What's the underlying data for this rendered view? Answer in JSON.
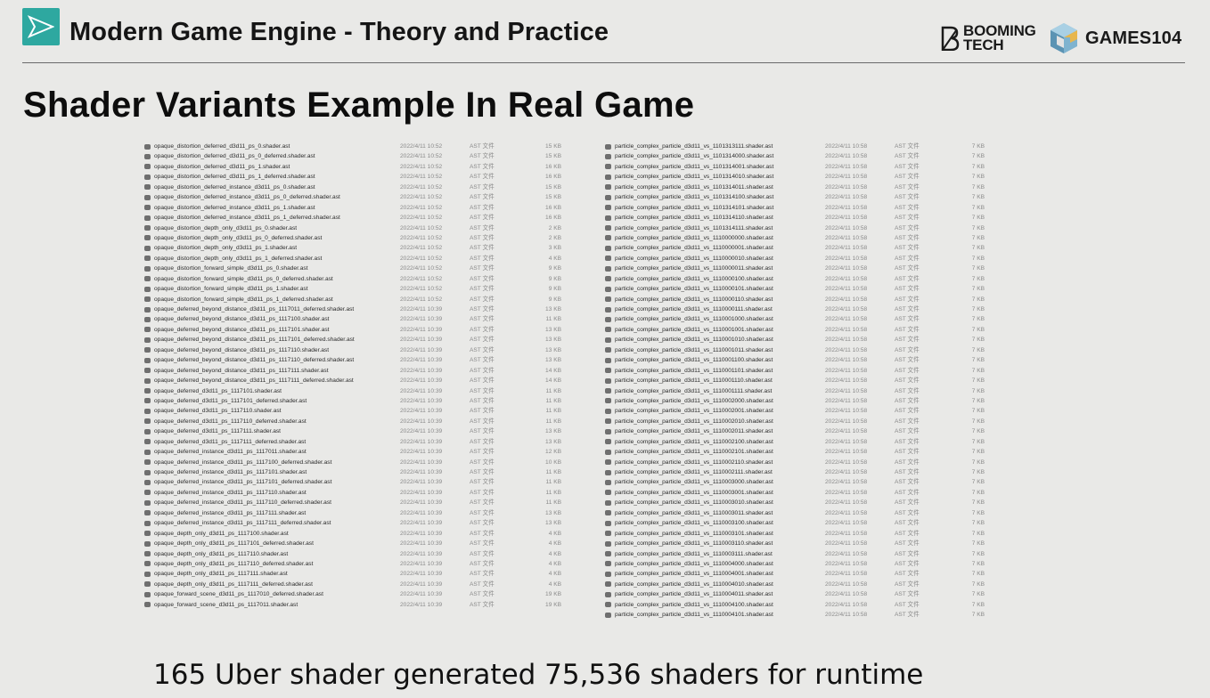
{
  "header": {
    "course_title": "Modern Game Engine - Theory and Practice",
    "booming_line1": "BOOMING",
    "booming_line2": "TECH",
    "games_label": "GAMES104",
    "accent_color": "#2ea8a0"
  },
  "slide": {
    "title": "Shader Variants Example In Real Game",
    "caption": "165 Uber shader generated 75,536 shaders for runtime"
  },
  "file_type_label": "AST 文件",
  "left_files": [
    {
      "name": "opaque_distortion_deferred_d3d11_ps_0.shader.ast",
      "date": "2022/4/11 10:52",
      "size": "15 KB"
    },
    {
      "name": "opaque_distortion_deferred_d3d11_ps_0_deferred.shader.ast",
      "date": "2022/4/11 10:52",
      "size": "15 KB"
    },
    {
      "name": "opaque_distortion_deferred_d3d11_ps_1.shader.ast",
      "date": "2022/4/11 10:52",
      "size": "16 KB"
    },
    {
      "name": "opaque_distortion_deferred_d3d11_ps_1_deferred.shader.ast",
      "date": "2022/4/11 10:52",
      "size": "16 KB"
    },
    {
      "name": "opaque_distortion_deferred_instance_d3d11_ps_0.shader.ast",
      "date": "2022/4/11 10:52",
      "size": "15 KB"
    },
    {
      "name": "opaque_distortion_deferred_instance_d3d11_ps_0_deferred.shader.ast",
      "date": "2022/4/11 10:52",
      "size": "15 KB"
    },
    {
      "name": "opaque_distortion_deferred_instance_d3d11_ps_1.shader.ast",
      "date": "2022/4/11 10:52",
      "size": "16 KB"
    },
    {
      "name": "opaque_distortion_deferred_instance_d3d11_ps_1_deferred.shader.ast",
      "date": "2022/4/11 10:52",
      "size": "16 KB"
    },
    {
      "name": "opaque_distortion_depth_only_d3d11_ps_0.shader.ast",
      "date": "2022/4/11 10:52",
      "size": "2 KB"
    },
    {
      "name": "opaque_distortion_depth_only_d3d11_ps_0_deferred.shader.ast",
      "date": "2022/4/11 10:52",
      "size": "2 KB"
    },
    {
      "name": "opaque_distortion_depth_only_d3d11_ps_1.shader.ast",
      "date": "2022/4/11 10:52",
      "size": "3 KB"
    },
    {
      "name": "opaque_distortion_depth_only_d3d11_ps_1_deferred.shader.ast",
      "date": "2022/4/11 10:52",
      "size": "4 KB"
    },
    {
      "name": "opaque_distortion_forward_simple_d3d11_ps_0.shader.ast",
      "date": "2022/4/11 10:52",
      "size": "9 KB"
    },
    {
      "name": "opaque_distortion_forward_simple_d3d11_ps_0_deferred.shader.ast",
      "date": "2022/4/11 10:52",
      "size": "9 KB"
    },
    {
      "name": "opaque_distortion_forward_simple_d3d11_ps_1.shader.ast",
      "date": "2022/4/11 10:52",
      "size": "9 KB"
    },
    {
      "name": "opaque_distortion_forward_simple_d3d11_ps_1_deferred.shader.ast",
      "date": "2022/4/11 10:52",
      "size": "9 KB"
    },
    {
      "name": "opaque_deferred_beyond_distance_d3d11_ps_1117011_deferred.shader.ast",
      "date": "2022/4/11 10:39",
      "size": "13 KB"
    },
    {
      "name": "opaque_deferred_beyond_distance_d3d11_ps_1117100.shader.ast",
      "date": "2022/4/11 10:39",
      "size": "11 KB"
    },
    {
      "name": "opaque_deferred_beyond_distance_d3d11_ps_1117101.shader.ast",
      "date": "2022/4/11 10:39",
      "size": "13 KB"
    },
    {
      "name": "opaque_deferred_beyond_distance_d3d11_ps_1117101_deferred.shader.ast",
      "date": "2022/4/11 10:39",
      "size": "13 KB"
    },
    {
      "name": "opaque_deferred_beyond_distance_d3d11_ps_1117110.shader.ast",
      "date": "2022/4/11 10:39",
      "size": "13 KB"
    },
    {
      "name": "opaque_deferred_beyond_distance_d3d11_ps_1117110_deferred.shader.ast",
      "date": "2022/4/11 10:39",
      "size": "13 KB"
    },
    {
      "name": "opaque_deferred_beyond_distance_d3d11_ps_1117111.shader.ast",
      "date": "2022/4/11 10:39",
      "size": "14 KB"
    },
    {
      "name": "opaque_deferred_beyond_distance_d3d11_ps_1117111_deferred.shader.ast",
      "date": "2022/4/11 10:39",
      "size": "14 KB"
    },
    {
      "name": "opaque_deferred_d3d11_ps_1117101.shader.ast",
      "date": "2022/4/11 10:39",
      "size": "11 KB"
    },
    {
      "name": "opaque_deferred_d3d11_ps_1117101_deferred.shader.ast",
      "date": "2022/4/11 10:39",
      "size": "11 KB"
    },
    {
      "name": "opaque_deferred_d3d11_ps_1117110.shader.ast",
      "date": "2022/4/11 10:39",
      "size": "11 KB"
    },
    {
      "name": "opaque_deferred_d3d11_ps_1117110_deferred.shader.ast",
      "date": "2022/4/11 10:39",
      "size": "11 KB"
    },
    {
      "name": "opaque_deferred_d3d11_ps_1117111.shader.ast",
      "date": "2022/4/11 10:39",
      "size": "13 KB"
    },
    {
      "name": "opaque_deferred_d3d11_ps_1117111_deferred.shader.ast",
      "date": "2022/4/11 10:39",
      "size": "13 KB"
    },
    {
      "name": "opaque_deferred_instance_d3d11_ps_1117011.shader.ast",
      "date": "2022/4/11 10:39",
      "size": "12 KB"
    },
    {
      "name": "opaque_deferred_instance_d3d11_ps_1117100_deferred.shader.ast",
      "date": "2022/4/11 10:39",
      "size": "10 KB"
    },
    {
      "name": "opaque_deferred_instance_d3d11_ps_1117101.shader.ast",
      "date": "2022/4/11 10:39",
      "size": "11 KB"
    },
    {
      "name": "opaque_deferred_instance_d3d11_ps_1117101_deferred.shader.ast",
      "date": "2022/4/11 10:39",
      "size": "11 KB"
    },
    {
      "name": "opaque_deferred_instance_d3d11_ps_1117110.shader.ast",
      "date": "2022/4/11 10:39",
      "size": "11 KB"
    },
    {
      "name": "opaque_deferred_instance_d3d11_ps_1117110_deferred.shader.ast",
      "date": "2022/4/11 10:39",
      "size": "11 KB"
    },
    {
      "name": "opaque_deferred_instance_d3d11_ps_1117111.shader.ast",
      "date": "2022/4/11 10:39",
      "size": "13 KB"
    },
    {
      "name": "opaque_deferred_instance_d3d11_ps_1117111_deferred.shader.ast",
      "date": "2022/4/11 10:39",
      "size": "13 KB"
    },
    {
      "name": "opaque_depth_only_d3d11_ps_1117100.shader.ast",
      "date": "2022/4/11 10:39",
      "size": "4 KB"
    },
    {
      "name": "opaque_depth_only_d3d11_ps_1117101_deferred.shader.ast",
      "date": "2022/4/11 10:39",
      "size": "4 KB"
    },
    {
      "name": "opaque_depth_only_d3d11_ps_1117110.shader.ast",
      "date": "2022/4/11 10:39",
      "size": "4 KB"
    },
    {
      "name": "opaque_depth_only_d3d11_ps_1117110_deferred.shader.ast",
      "date": "2022/4/11 10:39",
      "size": "4 KB"
    },
    {
      "name": "opaque_depth_only_d3d11_ps_1117111.shader.ast",
      "date": "2022/4/11 10:39",
      "size": "4 KB"
    },
    {
      "name": "opaque_depth_only_d3d11_ps_1117111_deferred.shader.ast",
      "date": "2022/4/11 10:39",
      "size": "4 KB"
    },
    {
      "name": "opaque_forward_scene_d3d11_ps_1117010_deferred.shader.ast",
      "date": "2022/4/11 10:39",
      "size": "19 KB"
    },
    {
      "name": "opaque_forward_scene_d3d11_ps_1117011.shader.ast",
      "date": "2022/4/11 10:39",
      "size": "19 KB"
    }
  ],
  "right_files": [
    {
      "name": "particle_complex_particle_d3d11_vs_1101313111.shader.ast",
      "date": "2022/4/11 10:58",
      "size": "7 KB"
    },
    {
      "name": "particle_complex_particle_d3d11_vs_1101314000.shader.ast",
      "date": "2022/4/11 10:58",
      "size": "7 KB"
    },
    {
      "name": "particle_complex_particle_d3d11_vs_1101314001.shader.ast",
      "date": "2022/4/11 10:58",
      "size": "7 KB"
    },
    {
      "name": "particle_complex_particle_d3d11_vs_1101314010.shader.ast",
      "date": "2022/4/11 10:58",
      "size": "7 KB"
    },
    {
      "name": "particle_complex_particle_d3d11_vs_1101314011.shader.ast",
      "date": "2022/4/11 10:58",
      "size": "7 KB"
    },
    {
      "name": "particle_complex_particle_d3d11_vs_1101314100.shader.ast",
      "date": "2022/4/11 10:58",
      "size": "7 KB"
    },
    {
      "name": "particle_complex_particle_d3d11_vs_1101314101.shader.ast",
      "date": "2022/4/11 10:58",
      "size": "7 KB"
    },
    {
      "name": "particle_complex_particle_d3d11_vs_1101314110.shader.ast",
      "date": "2022/4/11 10:58",
      "size": "7 KB"
    },
    {
      "name": "particle_complex_particle_d3d11_vs_1101314111.shader.ast",
      "date": "2022/4/11 10:58",
      "size": "7 KB"
    },
    {
      "name": "particle_complex_particle_d3d11_vs_1110000000.shader.ast",
      "date": "2022/4/11 10:58",
      "size": "7 KB"
    },
    {
      "name": "particle_complex_particle_d3d11_vs_1110000001.shader.ast",
      "date": "2022/4/11 10:58",
      "size": "7 KB"
    },
    {
      "name": "particle_complex_particle_d3d11_vs_1110000010.shader.ast",
      "date": "2022/4/11 10:58",
      "size": "7 KB"
    },
    {
      "name": "particle_complex_particle_d3d11_vs_1110000011.shader.ast",
      "date": "2022/4/11 10:58",
      "size": "7 KB"
    },
    {
      "name": "particle_complex_particle_d3d11_vs_1110000100.shader.ast",
      "date": "2022/4/11 10:58",
      "size": "7 KB"
    },
    {
      "name": "particle_complex_particle_d3d11_vs_1110000101.shader.ast",
      "date": "2022/4/11 10:58",
      "size": "7 KB"
    },
    {
      "name": "particle_complex_particle_d3d11_vs_1110000110.shader.ast",
      "date": "2022/4/11 10:58",
      "size": "7 KB"
    },
    {
      "name": "particle_complex_particle_d3d11_vs_1110000111.shader.ast",
      "date": "2022/4/11 10:58",
      "size": "7 KB"
    },
    {
      "name": "particle_complex_particle_d3d11_vs_1110001000.shader.ast",
      "date": "2022/4/11 10:58",
      "size": "7 KB"
    },
    {
      "name": "particle_complex_particle_d3d11_vs_1110001001.shader.ast",
      "date": "2022/4/11 10:58",
      "size": "7 KB"
    },
    {
      "name": "particle_complex_particle_d3d11_vs_1110001010.shader.ast",
      "date": "2022/4/11 10:58",
      "size": "7 KB"
    },
    {
      "name": "particle_complex_particle_d3d11_vs_1110001011.shader.ast",
      "date": "2022/4/11 10:58",
      "size": "7 KB"
    },
    {
      "name": "particle_complex_particle_d3d11_vs_1110001100.shader.ast",
      "date": "2022/4/11 10:58",
      "size": "7 KB"
    },
    {
      "name": "particle_complex_particle_d3d11_vs_1110001101.shader.ast",
      "date": "2022/4/11 10:58",
      "size": "7 KB"
    },
    {
      "name": "particle_complex_particle_d3d11_vs_1110001110.shader.ast",
      "date": "2022/4/11 10:58",
      "size": "7 KB"
    },
    {
      "name": "particle_complex_particle_d3d11_vs_1110001111.shader.ast",
      "date": "2022/4/11 10:58",
      "size": "7 KB"
    },
    {
      "name": "particle_complex_particle_d3d11_vs_1110002000.shader.ast",
      "date": "2022/4/11 10:58",
      "size": "7 KB"
    },
    {
      "name": "particle_complex_particle_d3d11_vs_1110002001.shader.ast",
      "date": "2022/4/11 10:58",
      "size": "7 KB"
    },
    {
      "name": "particle_complex_particle_d3d11_vs_1110002010.shader.ast",
      "date": "2022/4/11 10:58",
      "size": "7 KB"
    },
    {
      "name": "particle_complex_particle_d3d11_vs_1110002011.shader.ast",
      "date": "2022/4/11 10:58",
      "size": "7 KB"
    },
    {
      "name": "particle_complex_particle_d3d11_vs_1110002100.shader.ast",
      "date": "2022/4/11 10:58",
      "size": "7 KB"
    },
    {
      "name": "particle_complex_particle_d3d11_vs_1110002101.shader.ast",
      "date": "2022/4/11 10:58",
      "size": "7 KB"
    },
    {
      "name": "particle_complex_particle_d3d11_vs_1110002110.shader.ast",
      "date": "2022/4/11 10:58",
      "size": "7 KB"
    },
    {
      "name": "particle_complex_particle_d3d11_vs_1110002111.shader.ast",
      "date": "2022/4/11 10:58",
      "size": "7 KB"
    },
    {
      "name": "particle_complex_particle_d3d11_vs_1110003000.shader.ast",
      "date": "2022/4/11 10:58",
      "size": "7 KB"
    },
    {
      "name": "particle_complex_particle_d3d11_vs_1110003001.shader.ast",
      "date": "2022/4/11 10:58",
      "size": "7 KB"
    },
    {
      "name": "particle_complex_particle_d3d11_vs_1110003010.shader.ast",
      "date": "2022/4/11 10:58",
      "size": "7 KB"
    },
    {
      "name": "particle_complex_particle_d3d11_vs_1110003011.shader.ast",
      "date": "2022/4/11 10:58",
      "size": "7 KB"
    },
    {
      "name": "particle_complex_particle_d3d11_vs_1110003100.shader.ast",
      "date": "2022/4/11 10:58",
      "size": "7 KB"
    },
    {
      "name": "particle_complex_particle_d3d11_vs_1110003101.shader.ast",
      "date": "2022/4/11 10:58",
      "size": "7 KB"
    },
    {
      "name": "particle_complex_particle_d3d11_vs_1110003110.shader.ast",
      "date": "2022/4/11 10:58",
      "size": "7 KB"
    },
    {
      "name": "particle_complex_particle_d3d11_vs_1110003111.shader.ast",
      "date": "2022/4/11 10:58",
      "size": "7 KB"
    },
    {
      "name": "particle_complex_particle_d3d11_vs_1110004000.shader.ast",
      "date": "2022/4/11 10:58",
      "size": "7 KB"
    },
    {
      "name": "particle_complex_particle_d3d11_vs_1110004001.shader.ast",
      "date": "2022/4/11 10:58",
      "size": "7 KB"
    },
    {
      "name": "particle_complex_particle_d3d11_vs_1110004010.shader.ast",
      "date": "2022/4/11 10:58",
      "size": "7 KB"
    },
    {
      "name": "particle_complex_particle_d3d11_vs_1110004011.shader.ast",
      "date": "2022/4/11 10:58",
      "size": "7 KB"
    },
    {
      "name": "particle_complex_particle_d3d11_vs_1110004100.shader.ast",
      "date": "2022/4/11 10:58",
      "size": "7 KB"
    },
    {
      "name": "particle_complex_particle_d3d11_vs_1110004101.shader.ast",
      "date": "2022/4/11 10:58",
      "size": "7 KB"
    }
  ]
}
